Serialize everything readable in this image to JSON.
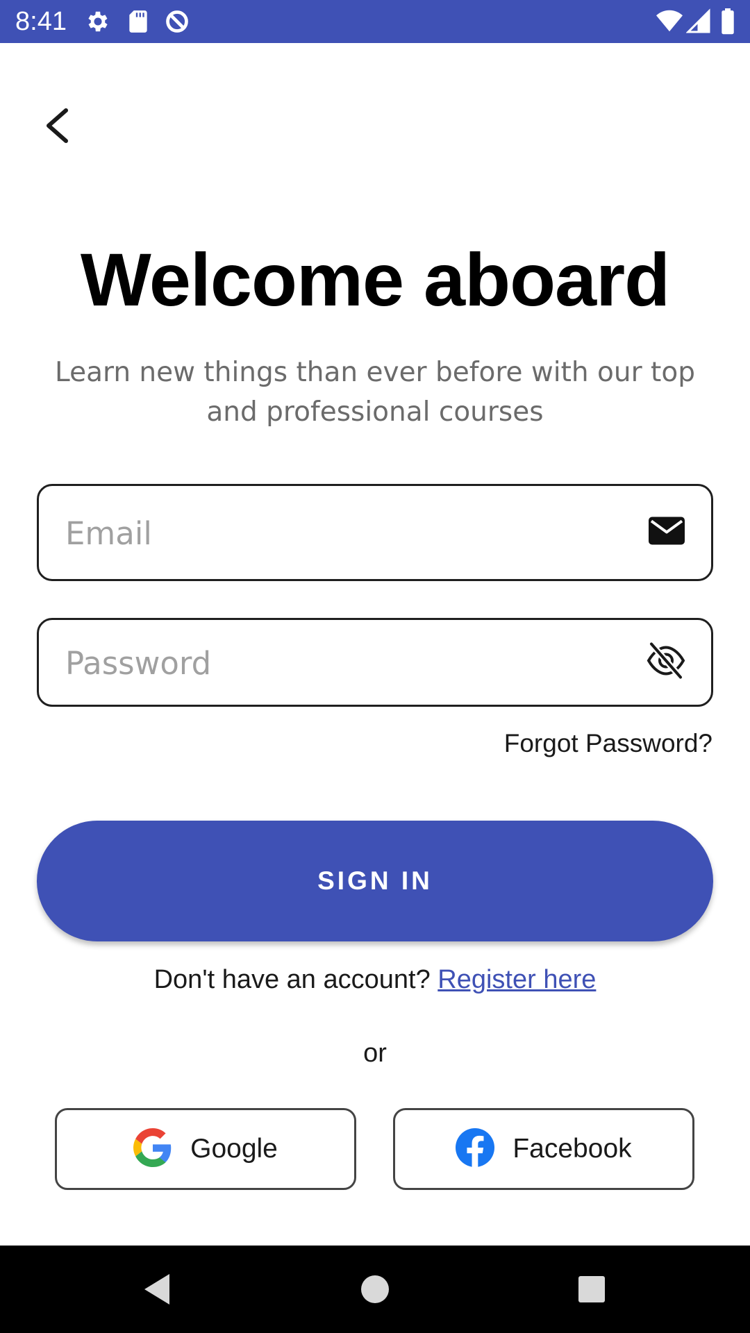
{
  "status_bar": {
    "time": "8:41",
    "icons": [
      "gear-icon",
      "sd-card-icon",
      "data-saver-icon",
      "wifi-icon",
      "signal-icon",
      "battery-icon"
    ],
    "background": "#3f51b5"
  },
  "header": {
    "back_icon": "chevron-left-icon"
  },
  "main": {
    "title": "Welcome aboard",
    "subtitle": "Learn new things than ever before with our top and professional courses",
    "email": {
      "value": "",
      "placeholder": "Email",
      "icon": "mail-icon"
    },
    "password": {
      "value": "",
      "placeholder": "Password",
      "icon": "eye-off-icon"
    },
    "forgot_password": "Forgot Password?",
    "sign_in_label": "SIGN IN",
    "register_prompt": "Don't have an account?",
    "register_link": "Register here",
    "or_label": "or",
    "social": [
      {
        "label": "Google",
        "icon": "google-icon"
      },
      {
        "label": "Facebook",
        "icon": "facebook-icon"
      }
    ]
  },
  "nav_bar": {
    "buttons": [
      "back-triangle-icon",
      "home-circle-icon",
      "recents-square-icon"
    ]
  },
  "colors": {
    "accent": "#3f51b5",
    "text": "#1a1a1a",
    "muted": "#6b6b6b",
    "placeholder": "#a0a0a0"
  }
}
